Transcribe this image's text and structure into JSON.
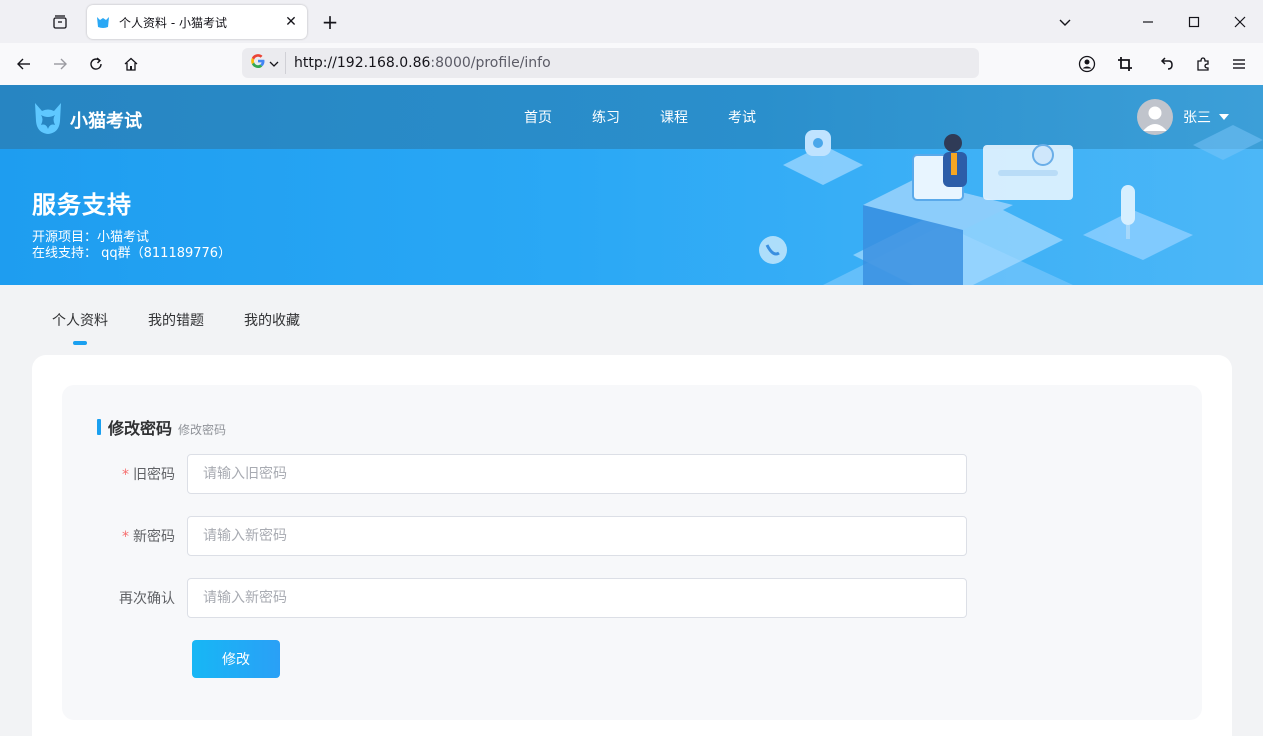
{
  "browser": {
    "tab_title": "个人资料 - 小猫考试",
    "url_host": "http://192.168.0.86",
    "url_rest": ":8000/profile/info"
  },
  "site": {
    "logo_text": "小猫考试",
    "nav": [
      "首页",
      "练习",
      "课程",
      "考试"
    ],
    "user_name": "张三"
  },
  "banner": {
    "title": "服务支持",
    "line1": "开源项目：小猫考试",
    "line2": "在线支持： qq群（811189776）"
  },
  "profile_tabs": [
    "个人资料",
    "我的错题",
    "我的收藏"
  ],
  "form": {
    "section_title": "修改密码",
    "section_subtitle": "修改密码",
    "fields": [
      {
        "label": "旧密码",
        "required": true,
        "placeholder": "请输入旧密码"
      },
      {
        "label": "新密码",
        "required": true,
        "placeholder": "请输入新密码"
      },
      {
        "label": "再次确认",
        "required": false,
        "placeholder": "请输入新密码"
      }
    ],
    "submit_label": "修改"
  },
  "colors": {
    "accent": "#1aa0f0",
    "required": "#f56c6c"
  }
}
